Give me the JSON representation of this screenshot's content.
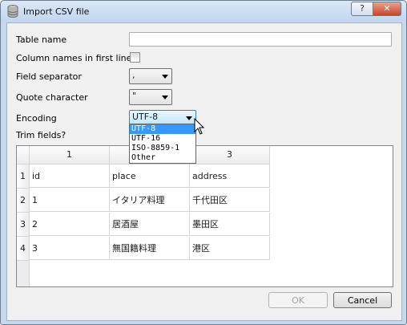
{
  "window": {
    "title": "Import CSV file",
    "help_label": "?",
    "close_label": "✕"
  },
  "form": {
    "table_name_label": "Table name",
    "table_name_value": "",
    "column_names_label": "Column names in first line",
    "field_separator_label": "Field separator",
    "field_separator_value": ",",
    "quote_character_label": "Quote character",
    "quote_character_value": "\"",
    "encoding_label": "Encoding",
    "encoding_value": "UTF-8",
    "encoding_options": [
      "UTF-8",
      "UTF-16",
      "ISO-8859-1",
      "Other"
    ],
    "trim_fields_label": "Trim fields?"
  },
  "preview": {
    "columns": [
      "1",
      "2",
      "3"
    ],
    "row_numbers": [
      "1",
      "2",
      "3",
      "4"
    ],
    "rows": [
      [
        "id",
        "place",
        "address"
      ],
      [
        "1",
        "イタリア料理",
        "千代田区"
      ],
      [
        "2",
        "居酒屋",
        "墨田区"
      ],
      [
        "3",
        "無国籍料理",
        "港区"
      ]
    ]
  },
  "buttons": {
    "ok_label": "OK",
    "cancel_label": "Cancel"
  }
}
